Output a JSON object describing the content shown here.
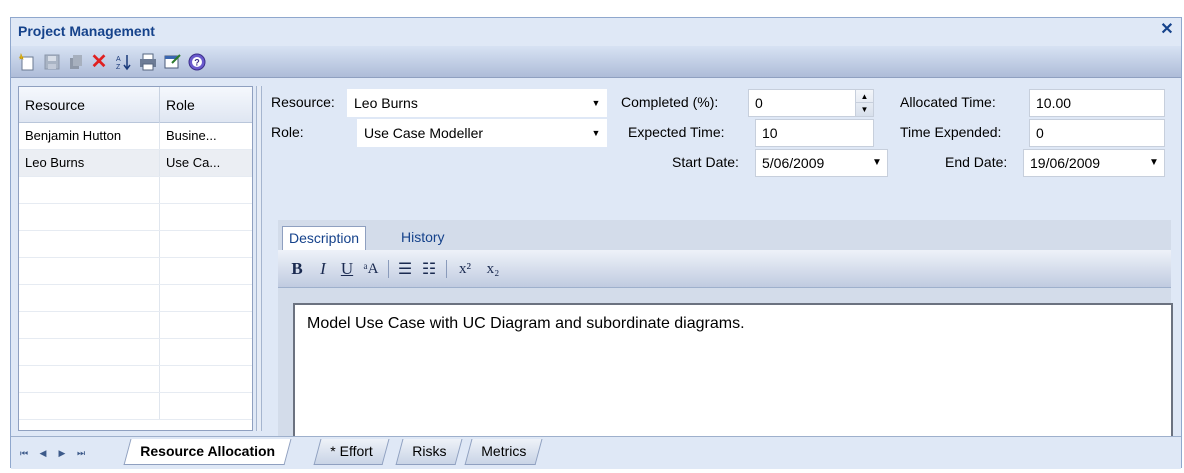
{
  "window": {
    "title": "Project Management",
    "close_glyph": "✕"
  },
  "toolbar": {
    "buttons": [
      {
        "name": "new-icon",
        "label": "New"
      },
      {
        "name": "save-icon",
        "label": "Save"
      },
      {
        "name": "copy-icon",
        "label": "Copy"
      },
      {
        "name": "delete-icon",
        "label": "Delete"
      },
      {
        "name": "sort-icon",
        "label": "Sort"
      },
      {
        "name": "print-icon",
        "label": "Print"
      },
      {
        "name": "properties-icon",
        "label": "Properties"
      },
      {
        "name": "help-icon",
        "label": "Help"
      }
    ],
    "delete_color": "#e02020"
  },
  "grid": {
    "columns": [
      "Resource",
      "Role"
    ],
    "rows": [
      {
        "resource": "Benjamin Hutton",
        "role": "Busine..."
      },
      {
        "resource": "Leo Burns",
        "role": "Use Ca..."
      }
    ],
    "selected_row": 1
  },
  "form": {
    "resource_label": "Resource:",
    "resource_value": "Leo Burns",
    "role_label": "Role:",
    "role_value": "Use Case Modeller",
    "completed_label": "Completed (%):",
    "completed_value": "0",
    "expected_label": "Expected Time:",
    "expected_value": "10",
    "start_label": "Start Date:",
    "start_value": "5/06/2009",
    "allocated_label": "Allocated Time:",
    "allocated_value": "10.00",
    "expended_label": "Time Expended:",
    "expended_value": "0",
    "end_label": "End Date:",
    "end_value": "19/06/2009"
  },
  "description": {
    "tabs": [
      "Description",
      "History"
    ],
    "active_tab": "Description",
    "format_buttons": {
      "bold": "B",
      "italic": "I",
      "underline": "U",
      "font_color": "ᵃA",
      "bullets": "☰",
      "numbering": "☷",
      "superscript": "x²",
      "subscript": "x₂"
    },
    "text": "Model Use Case with UC Diagram and subordinate diagrams."
  },
  "bottom_tabs": {
    "nav": [
      "⏮",
      "◀",
      "▶",
      "⏭"
    ],
    "tabs": [
      "Resource Allocation",
      "* Effort",
      "Risks",
      "Metrics"
    ],
    "active": "Resource Allocation"
  },
  "colors": {
    "accent": "#15428b",
    "panel_bg": "#dfe8f6"
  }
}
